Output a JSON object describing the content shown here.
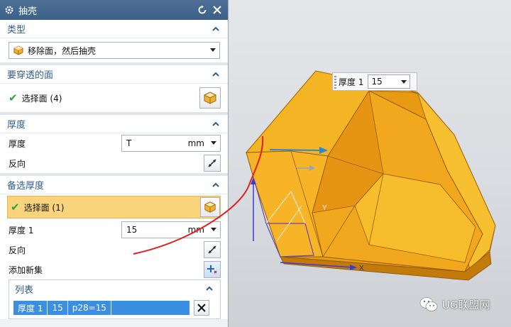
{
  "dialog": {
    "title": "抽壳",
    "type_group": {
      "label": "类型",
      "selected": "移除面，然后抽壳"
    },
    "pierce_group": {
      "label": "要穿透的面",
      "select_label": "选择面 (4)"
    },
    "thickness_group": {
      "label": "厚度",
      "thickness_label": "厚度",
      "thickness_value": "T",
      "unit": "mm",
      "reverse_label": "反向"
    },
    "alt_group": {
      "label": "备选厚度",
      "select_label": "选择面 (1)",
      "thickness_label": "厚度 1",
      "thickness_value": "15",
      "unit": "mm",
      "reverse_label": "反向",
      "add_set_label": "添加新集",
      "list": {
        "label": "列表",
        "row": [
          "厚度 1",
          "15",
          "p28=15"
        ]
      }
    }
  },
  "viewport": {
    "float_label": "厚度 1",
    "float_value": "15",
    "axis_x": "X",
    "axis_y": "Y"
  },
  "watermark": "UG联盟网",
  "colors": {
    "accent": "#3c5f88",
    "highlight": "#fad37d",
    "model": "#f5b21f",
    "check": "#2aa43a"
  }
}
